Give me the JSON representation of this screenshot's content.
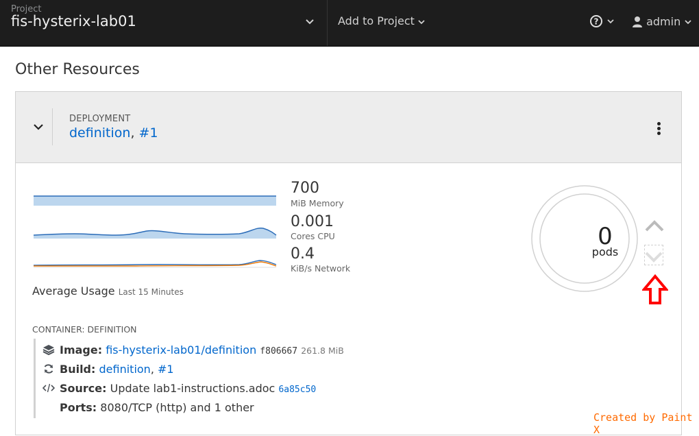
{
  "topbar": {
    "project_caption": "Project",
    "project_name": "fis-hysterix-lab01",
    "add_to_project": "Add to Project",
    "user": "admin"
  },
  "page": {
    "title": "Other Resources"
  },
  "deployment": {
    "kind": "DEPLOYMENT",
    "name": "definition",
    "separator": ",",
    "revision": "#1"
  },
  "metrics": {
    "memory": {
      "value": "700",
      "unit": "MiB Memory"
    },
    "cpu": {
      "value": "0.001",
      "unit": "Cores CPU"
    },
    "network": {
      "value": "0.4",
      "unit": "KiB/s Network"
    },
    "average_label": "Average Usage",
    "average_period": "Last 15 Minutes"
  },
  "pods": {
    "count": "0",
    "label": "pods"
  },
  "container": {
    "title": "CONTAINER: DEFINITION",
    "image_label": "Image:",
    "image_link": "fis-hysterix-lab01/definition",
    "image_hash": "f806667",
    "image_size": "261.8 MiB",
    "build_label": "Build:",
    "build_link": "definition",
    "build_sep": ",",
    "build_rev": "#1",
    "source_label": "Source:",
    "source_text": "Update lab1-instructions.adoc",
    "source_commit": "6a85c50",
    "ports_label": "Ports:",
    "ports_text": "8080/TCP (http) and 1 other"
  },
  "watermark": "Created by Paint X",
  "colors": {
    "accent": "#0066cc",
    "topbar": "#1d1d1d",
    "chart_fill": "#bcd6ee",
    "chart_line": "#2b6cb8",
    "network_orange": "#ec7a08",
    "annotation": "#ff0000"
  }
}
